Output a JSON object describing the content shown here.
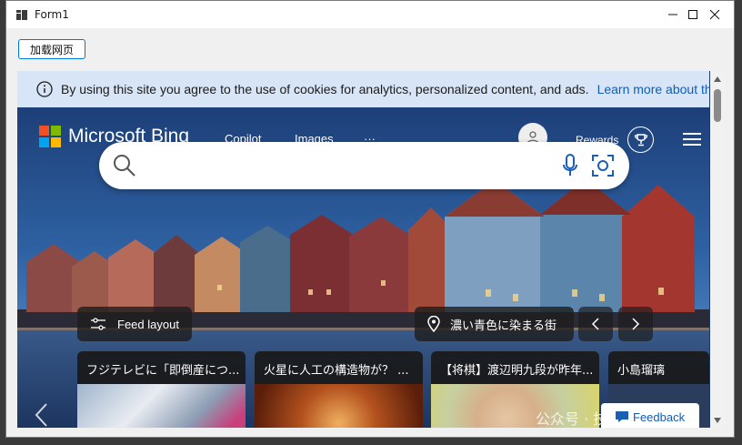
{
  "window": {
    "title": "Form1"
  },
  "toolbar": {
    "load_label": "加载网页"
  },
  "cookie_banner": {
    "message": "By using this site you agree to the use of cookies for analytics, personalized content, and ads.",
    "link": "Learn more about third party"
  },
  "bing": {
    "brand": "Microsoft Bing",
    "nav": [
      "Copilot",
      "Images",
      "···"
    ],
    "rewards_label": "Rewards",
    "feed_layout_label": "Feed layout",
    "image_caption": "濃い青色に染まる街",
    "feedback_label": "Feedback",
    "news_cards": [
      {
        "title": "フジテレビに「即倒産につ..."
      },
      {
        "title": "火星に人工の構造物が？ ..."
      },
      {
        "title": "【将棋】渡辺明九段が昨年..."
      },
      {
        "title": "小島瑠璃"
      }
    ]
  },
  "overlay": {
    "watermark": "公众号 · 技术老小子"
  },
  "colors": {
    "accent": "#0078d7",
    "link": "#0f5db8",
    "banner": "#d8e5f6"
  }
}
